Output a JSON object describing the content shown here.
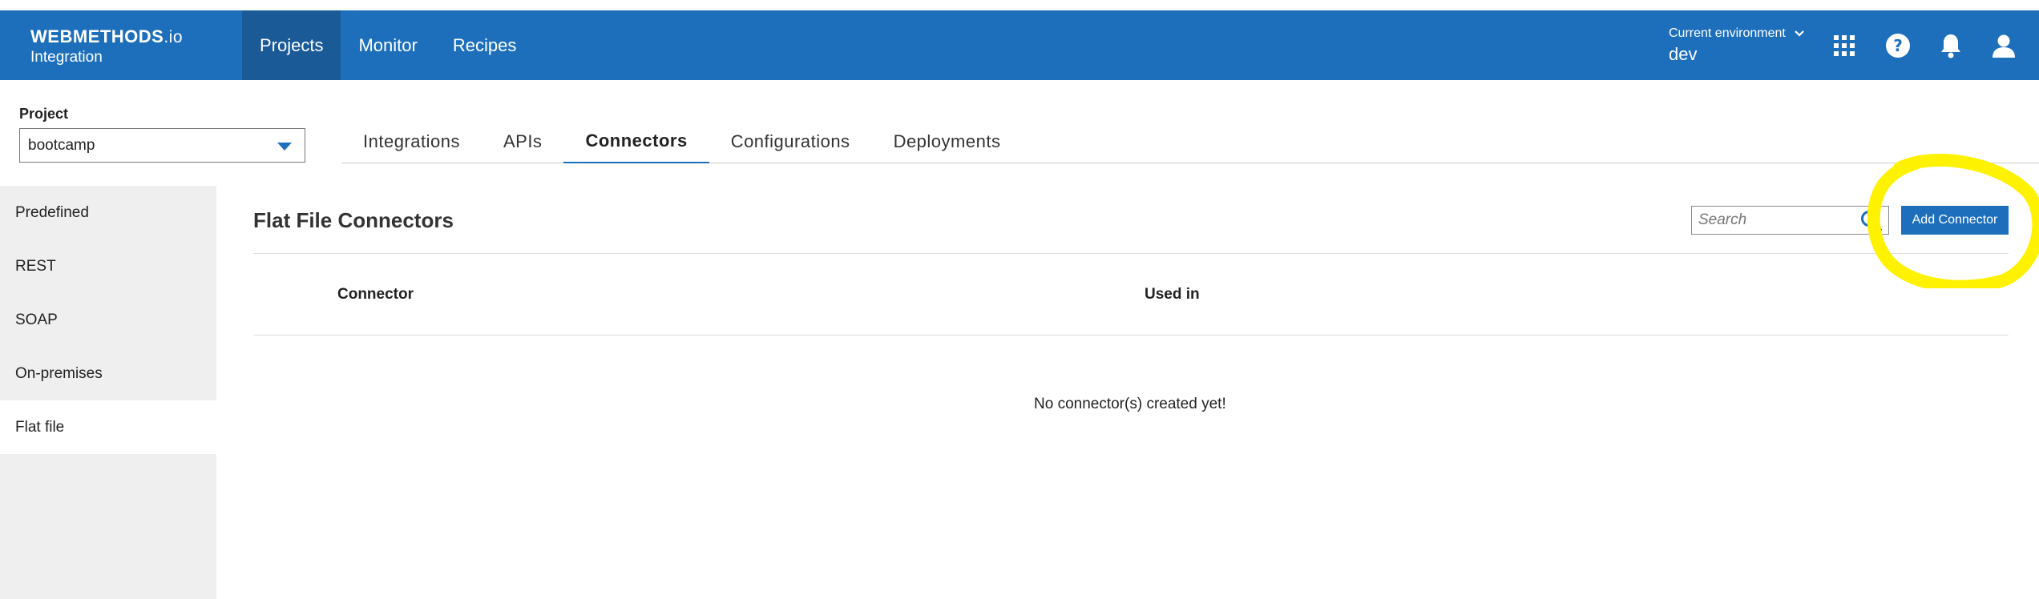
{
  "header": {
    "brand": "WEBMETHODS",
    "brand_suffix": ".io",
    "product": "Integration",
    "nav": [
      "Projects",
      "Monitor",
      "Recipes"
    ],
    "env_label": "Current environment",
    "env_value": "dev"
  },
  "project": {
    "label": "Project",
    "selected": "bootcamp"
  },
  "tabs": [
    "Integrations",
    "APIs",
    "Connectors",
    "Configurations",
    "Deployments"
  ],
  "sidebar": {
    "items": [
      "Predefined",
      "REST",
      "SOAP",
      "On-premises",
      "Flat file"
    ]
  },
  "main": {
    "title": "Flat File Connectors",
    "search_placeholder": "Search",
    "add_button": "Add Connector",
    "columns": [
      "Connector",
      "Used in"
    ],
    "empty_message": "No connector(s) created yet!"
  },
  "colors": {
    "header": "#1e6fbb",
    "active_nav": "#195a97",
    "highlight": "#fff200"
  }
}
